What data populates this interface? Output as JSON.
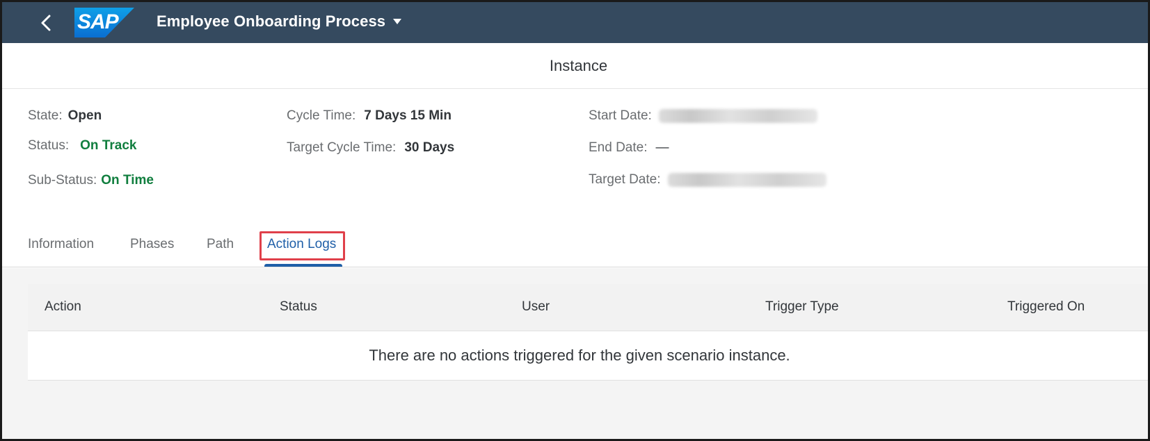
{
  "shell": {
    "logo_text": "SAP",
    "app_title": "Employee Onboarding Process",
    "colors": {
      "shell_bg": "#354a5f",
      "logo_blue": "#0a6ed1"
    }
  },
  "page": {
    "title": "Instance"
  },
  "header": {
    "state_label": "State:",
    "state_value": "Open",
    "status_label": "Status:",
    "status_value": "On Track",
    "substatus_label": "Sub-Status:",
    "substatus_value": "On Time",
    "cycle_time_label": "Cycle Time:",
    "cycle_time_value": "7 Days 15 Min",
    "target_cycle_time_label": "Target Cycle Time:",
    "target_cycle_time_value": "30 Days",
    "start_date_label": "Start Date:",
    "end_date_label": "End Date:",
    "end_date_value": "—",
    "target_date_label": "Target Date:",
    "status_color": "#107e3e"
  },
  "tabs": [
    {
      "label": "Information"
    },
    {
      "label": "Phases"
    },
    {
      "label": "Path"
    },
    {
      "label": "Action Logs",
      "selected": true
    }
  ],
  "table": {
    "columns": [
      "Action",
      "Status",
      "User",
      "Trigger Type",
      "Triggered On"
    ],
    "empty_text": "There are no actions triggered for the given scenario instance."
  }
}
